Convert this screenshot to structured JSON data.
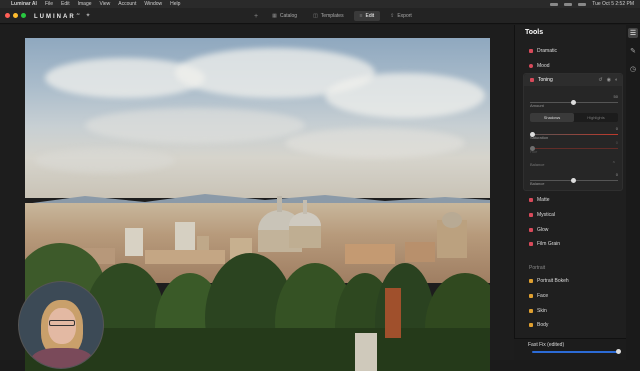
{
  "menubar": {
    "items": [
      "Luminar AI",
      "File",
      "Edit",
      "Image",
      "View",
      "Account",
      "Window",
      "Help"
    ],
    "clock": "Tue Oct 5 2:52 PM"
  },
  "toolbar": {
    "logo": "LUMINAR",
    "logo_suffix": "AI",
    "tabs": [
      {
        "label": "Catalog",
        "active": false
      },
      {
        "label": "Templates",
        "active": false
      },
      {
        "label": "Edit",
        "active": true
      },
      {
        "label": "Export",
        "active": false
      }
    ]
  },
  "panel": {
    "title": "Tools",
    "tools_top": [
      {
        "label": "Dramatic",
        "color": "#d84a5a"
      },
      {
        "label": "Mood",
        "color": "#d84a5a"
      }
    ],
    "toning": {
      "label": "Toning",
      "amount_label": "Amount",
      "amount_value": "50",
      "amount": 0.5,
      "seg_left": "Shadows",
      "seg_right": "Highlights",
      "saturation_label": "Saturation",
      "saturation_value": "0",
      "hue_label": "Hue",
      "hue_value": "0",
      "balance_section": "Balance",
      "balance_label": "Balance",
      "balance_value": "0"
    },
    "tools_mid": [
      {
        "label": "Matte",
        "color": "#d84a5a"
      },
      {
        "label": "Mystical",
        "color": "#d84a5a"
      },
      {
        "label": "Glow",
        "color": "#d84a5a"
      },
      {
        "label": "Film Grain",
        "color": "#d84a5a"
      }
    ],
    "portrait_section": "Portrait",
    "tools_portrait": [
      {
        "label": "Portrait Bokeh",
        "color": "#e0a030"
      },
      {
        "label": "Face",
        "color": "#e0a030"
      },
      {
        "label": "Skin",
        "color": "#e0a030"
      },
      {
        "label": "Body",
        "color": "#e0a030"
      }
    ],
    "bottom_label": "Fast Fix (edited)"
  }
}
